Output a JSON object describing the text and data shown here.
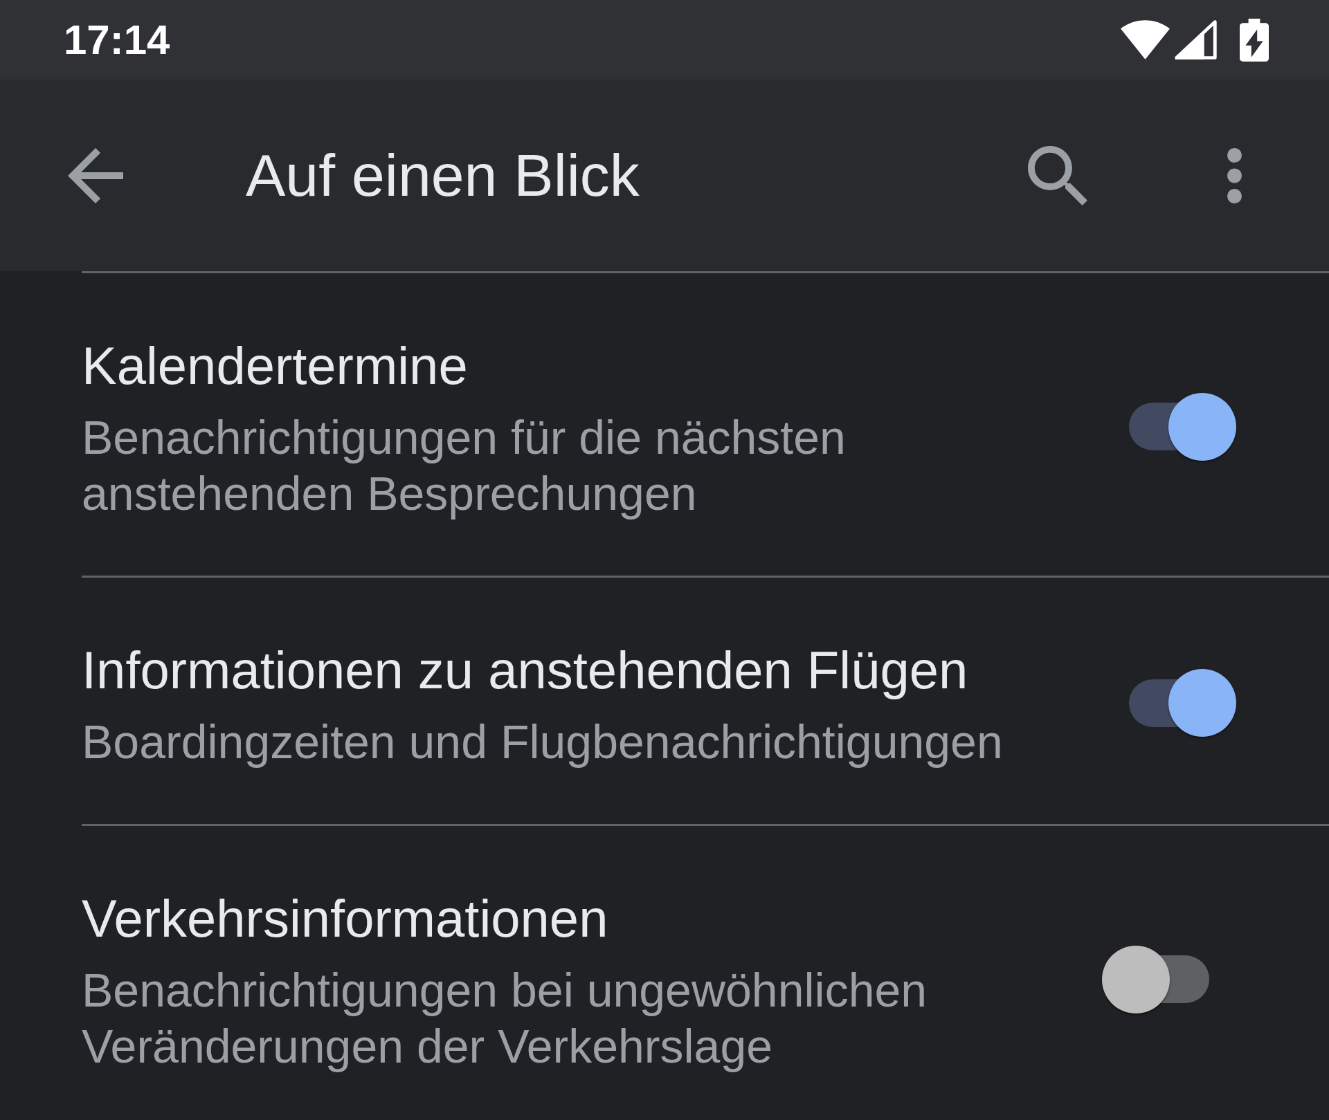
{
  "status_bar": {
    "time": "17:14"
  },
  "app_bar": {
    "title": "Auf einen Blick"
  },
  "settings": [
    {
      "title": "Kalendertermine",
      "description": "Benachrichtigungen für die nächsten anstehenden Besprechungen",
      "on": true
    },
    {
      "title": "Informationen zu anstehenden Flügen",
      "description": "Boardingzeiten und Flugbenachrichtigungen",
      "on": true
    },
    {
      "title": "Verkehrsinformationen",
      "description": "Benachrichtigungen bei ungewöhnlichen Veränderungen der Verkehrslage",
      "on": false
    }
  ]
}
